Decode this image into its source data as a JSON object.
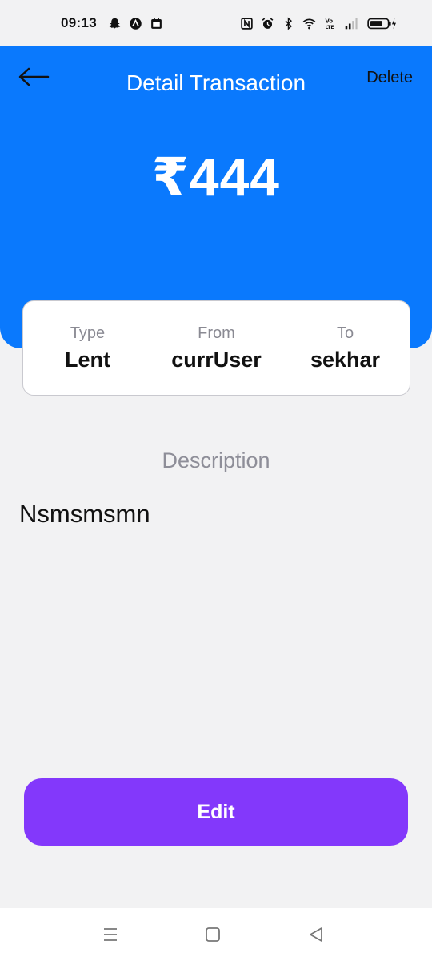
{
  "status_bar": {
    "time": "09:13",
    "left_icons": [
      "snapchat-icon",
      "arrow-app-icon",
      "calendar-app-icon"
    ],
    "right_icons": [
      "nfc-icon",
      "alarm-icon",
      "bluetooth-icon",
      "wifi-icon",
      "volte-icon",
      "signal-icon",
      "battery-icon"
    ]
  },
  "header": {
    "title": "Detail Transaction",
    "delete_label": "Delete",
    "amount": "₹444",
    "background": "#0a79fd"
  },
  "info": {
    "type_label": "Type",
    "type_value": "Lent",
    "from_label": "From",
    "from_value": "currUser",
    "to_label": "To",
    "to_value": "sekhar"
  },
  "description": {
    "label": "Description",
    "text": "Nsmsmsmn"
  },
  "actions": {
    "edit_label": "Edit",
    "edit_color": "#8338fb"
  },
  "nav": {
    "icons": [
      "menu-icon",
      "home-square-icon",
      "back-triangle-icon"
    ]
  }
}
